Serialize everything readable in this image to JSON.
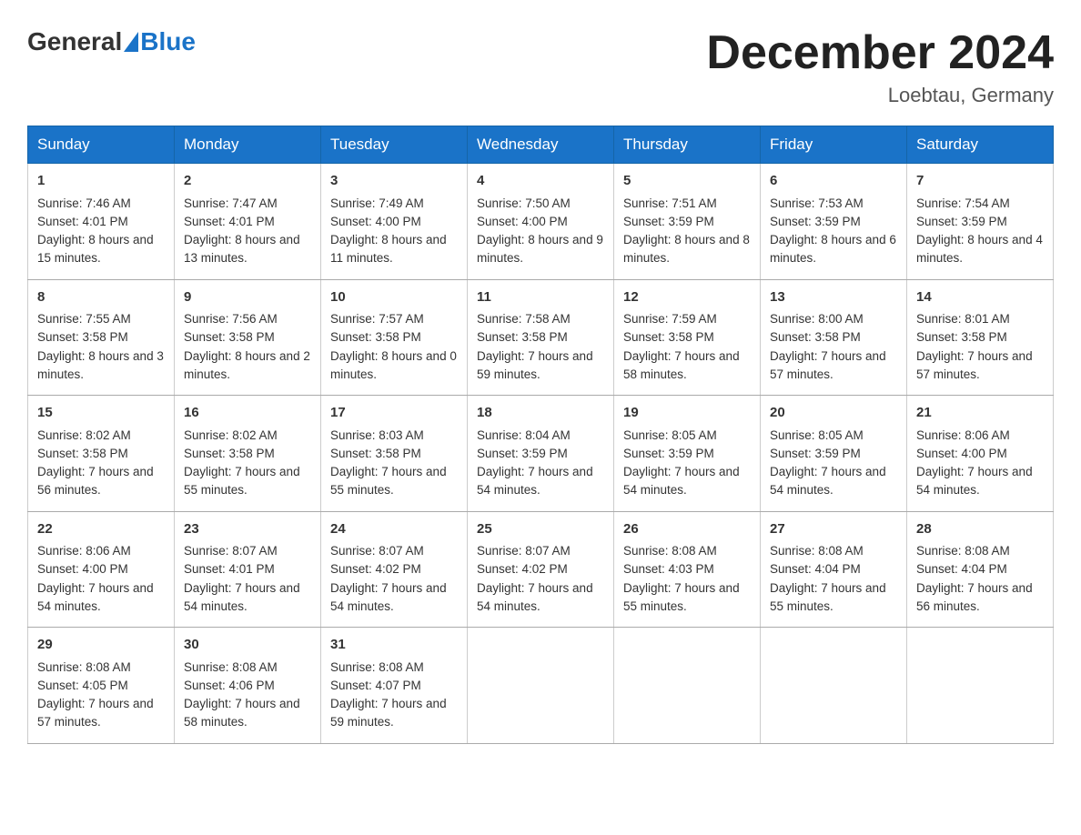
{
  "header": {
    "logo_general": "General",
    "logo_blue": "Blue",
    "title": "December 2024",
    "location": "Loebtau, Germany"
  },
  "days_of_week": [
    "Sunday",
    "Monday",
    "Tuesday",
    "Wednesday",
    "Thursday",
    "Friday",
    "Saturday"
  ],
  "weeks": [
    [
      {
        "day": "1",
        "sunrise": "7:46 AM",
        "sunset": "4:01 PM",
        "daylight": "8 hours and 15 minutes."
      },
      {
        "day": "2",
        "sunrise": "7:47 AM",
        "sunset": "4:01 PM",
        "daylight": "8 hours and 13 minutes."
      },
      {
        "day": "3",
        "sunrise": "7:49 AM",
        "sunset": "4:00 PM",
        "daylight": "8 hours and 11 minutes."
      },
      {
        "day": "4",
        "sunrise": "7:50 AM",
        "sunset": "4:00 PM",
        "daylight": "8 hours and 9 minutes."
      },
      {
        "day": "5",
        "sunrise": "7:51 AM",
        "sunset": "3:59 PM",
        "daylight": "8 hours and 8 minutes."
      },
      {
        "day": "6",
        "sunrise": "7:53 AM",
        "sunset": "3:59 PM",
        "daylight": "8 hours and 6 minutes."
      },
      {
        "day": "7",
        "sunrise": "7:54 AM",
        "sunset": "3:59 PM",
        "daylight": "8 hours and 4 minutes."
      }
    ],
    [
      {
        "day": "8",
        "sunrise": "7:55 AM",
        "sunset": "3:58 PM",
        "daylight": "8 hours and 3 minutes."
      },
      {
        "day": "9",
        "sunrise": "7:56 AM",
        "sunset": "3:58 PM",
        "daylight": "8 hours and 2 minutes."
      },
      {
        "day": "10",
        "sunrise": "7:57 AM",
        "sunset": "3:58 PM",
        "daylight": "8 hours and 0 minutes."
      },
      {
        "day": "11",
        "sunrise": "7:58 AM",
        "sunset": "3:58 PM",
        "daylight": "7 hours and 59 minutes."
      },
      {
        "day": "12",
        "sunrise": "7:59 AM",
        "sunset": "3:58 PM",
        "daylight": "7 hours and 58 minutes."
      },
      {
        "day": "13",
        "sunrise": "8:00 AM",
        "sunset": "3:58 PM",
        "daylight": "7 hours and 57 minutes."
      },
      {
        "day": "14",
        "sunrise": "8:01 AM",
        "sunset": "3:58 PM",
        "daylight": "7 hours and 57 minutes."
      }
    ],
    [
      {
        "day": "15",
        "sunrise": "8:02 AM",
        "sunset": "3:58 PM",
        "daylight": "7 hours and 56 minutes."
      },
      {
        "day": "16",
        "sunrise": "8:02 AM",
        "sunset": "3:58 PM",
        "daylight": "7 hours and 55 minutes."
      },
      {
        "day": "17",
        "sunrise": "8:03 AM",
        "sunset": "3:58 PM",
        "daylight": "7 hours and 55 minutes."
      },
      {
        "day": "18",
        "sunrise": "8:04 AM",
        "sunset": "3:59 PM",
        "daylight": "7 hours and 54 minutes."
      },
      {
        "day": "19",
        "sunrise": "8:05 AM",
        "sunset": "3:59 PM",
        "daylight": "7 hours and 54 minutes."
      },
      {
        "day": "20",
        "sunrise": "8:05 AM",
        "sunset": "3:59 PM",
        "daylight": "7 hours and 54 minutes."
      },
      {
        "day": "21",
        "sunrise": "8:06 AM",
        "sunset": "4:00 PM",
        "daylight": "7 hours and 54 minutes."
      }
    ],
    [
      {
        "day": "22",
        "sunrise": "8:06 AM",
        "sunset": "4:00 PM",
        "daylight": "7 hours and 54 minutes."
      },
      {
        "day": "23",
        "sunrise": "8:07 AM",
        "sunset": "4:01 PM",
        "daylight": "7 hours and 54 minutes."
      },
      {
        "day": "24",
        "sunrise": "8:07 AM",
        "sunset": "4:02 PM",
        "daylight": "7 hours and 54 minutes."
      },
      {
        "day": "25",
        "sunrise": "8:07 AM",
        "sunset": "4:02 PM",
        "daylight": "7 hours and 54 minutes."
      },
      {
        "day": "26",
        "sunrise": "8:08 AM",
        "sunset": "4:03 PM",
        "daylight": "7 hours and 55 minutes."
      },
      {
        "day": "27",
        "sunrise": "8:08 AM",
        "sunset": "4:04 PM",
        "daylight": "7 hours and 55 minutes."
      },
      {
        "day": "28",
        "sunrise": "8:08 AM",
        "sunset": "4:04 PM",
        "daylight": "7 hours and 56 minutes."
      }
    ],
    [
      {
        "day": "29",
        "sunrise": "8:08 AM",
        "sunset": "4:05 PM",
        "daylight": "7 hours and 57 minutes."
      },
      {
        "day": "30",
        "sunrise": "8:08 AM",
        "sunset": "4:06 PM",
        "daylight": "7 hours and 58 minutes."
      },
      {
        "day": "31",
        "sunrise": "8:08 AM",
        "sunset": "4:07 PM",
        "daylight": "7 hours and 59 minutes."
      },
      null,
      null,
      null,
      null
    ]
  ],
  "labels": {
    "sunrise": "Sunrise:",
    "sunset": "Sunset:",
    "daylight": "Daylight:"
  }
}
